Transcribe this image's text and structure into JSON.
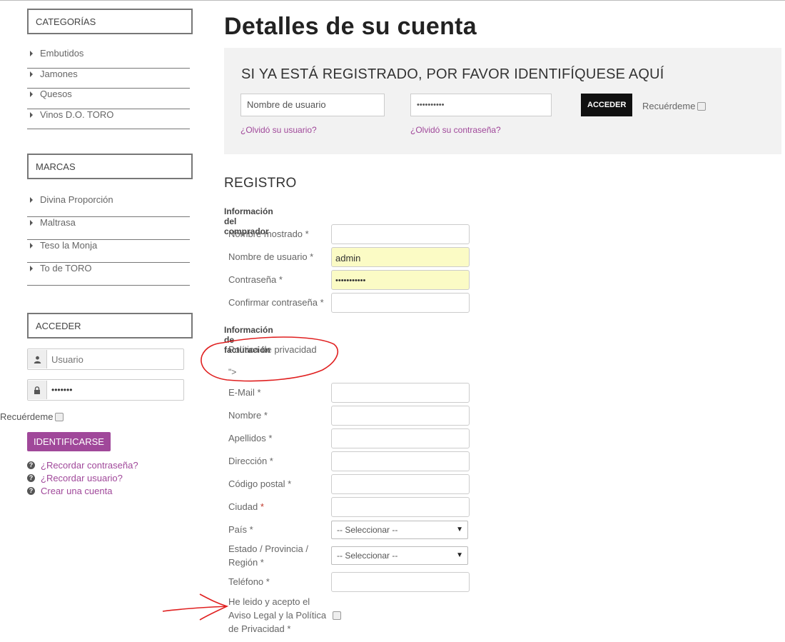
{
  "sidebar": {
    "categories_title": "CATEGORÍAS",
    "categories": [
      "Embutidos",
      "Jamones",
      "Quesos",
      "Vinos D.O. TORO"
    ],
    "brands_title": "MARCAS",
    "brands": [
      "Divina Proporción",
      "Maltrasa",
      "Teso la Monja",
      "To de TORO"
    ],
    "login_title": "ACCEDER",
    "username_placeholder": "Usuario",
    "password_value": "•••••••",
    "remember_label": "Recuérdeme",
    "login_button": "IDENTIFICARSE",
    "links": [
      "¿Recordar contraseña?",
      "¿Recordar usuario?",
      "Crear una cuenta"
    ]
  },
  "main": {
    "page_title": "Detalles de su cuenta",
    "login_panel": {
      "title": "SI YA ESTÁ REGISTRADO, POR FAVOR IDENTIFÍQUESE AQUÍ",
      "username_placeholder": "Nombre de usuario",
      "password_value": "••••••••••",
      "submit_label": "ACCEDER",
      "remember_label": "Recuérdeme",
      "forgot_user": "¿Olvidó su usuario?",
      "forgot_password": "¿Olvidó su contraseña?"
    },
    "registration": {
      "title": "REGISTRO",
      "buyer_section": "Información del comprador",
      "display_name_label": "Nombre mostrado *",
      "username_label": "Nombre de usuario *",
      "username_value": "admin",
      "password_label": "Contraseña *",
      "password_value": "•••••••••••",
      "confirm_password_label": "Confirmar contraseña *",
      "billing_section": "Información de facturación",
      "privacy_policy_label": "Política de privacidad",
      "stray_text": "\">",
      "email_label": "E-Mail *",
      "first_name_label": "Nombre *",
      "last_name_label": "Apellidos *",
      "address_label": "Dirección *",
      "postal_code_label": "Código postal *",
      "city_label": "Ciudad",
      "required_mark": "*",
      "country_label": "País *",
      "country_select": "-- Seleccionar --",
      "state_label_line1": "Estado / Provincia /",
      "state_label_line2": "Región *",
      "state_select": "-- Seleccionar --",
      "phone_label": "Teléfono *",
      "terms_line1": "He leido y acepto el",
      "terms_line2": "Aviso Legal y la Política",
      "terms_line3": "de Privacidad *"
    }
  },
  "colors": {
    "accent_purple": "#a0489a",
    "annotation_red": "#e02020",
    "autofill_yellow": "#fbfbc5"
  }
}
